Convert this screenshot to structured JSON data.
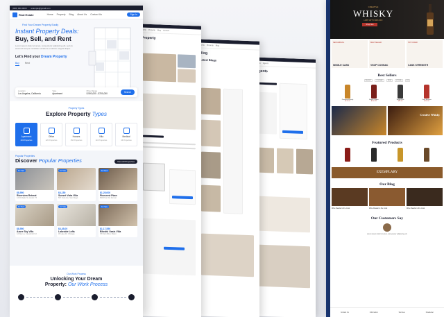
{
  "front": {
    "topbar": {
      "phone": "(000) 000-0000",
      "email": "example@gmail.com"
    },
    "logo": "Real Estate",
    "nav": [
      "Home",
      "Property",
      "Blog",
      "About Us",
      "Contact Us"
    ],
    "signin": "Sign In",
    "hero": {
      "eyebrow": "Find Your Dream Property Easily",
      "title1": "Instant Property Deals:",
      "title2": "Buy, Sell, and Rent",
      "desc": "Lorem ipsum dolor sit amet, consectetur adipiscing elit, sed do eiusmod tempor incididunt ut labore et dolore magna aliqua.",
      "find_prefix": "Let's Find your ",
      "find_highlight": "Dream Property",
      "tabs": [
        "Buy",
        "Rent"
      ],
      "search": {
        "location_label": "Location",
        "location_value": "Los Angeles, California",
        "type_label": "Type",
        "type_value": "Apartment",
        "price_label": "Price Range",
        "price_value": "$ 500,000 - $700,000",
        "button": "Search"
      }
    },
    "types": {
      "eyebrow": "Property Types",
      "title": "Explore Property",
      "title_em": "Types",
      "items": [
        {
          "name": "Apartment",
          "count": "234 Properties"
        },
        {
          "name": "Office",
          "count": "120 Properties"
        },
        {
          "name": "Houses",
          "count": "150 Properties"
        },
        {
          "name": "Villa",
          "count": "110 Properties"
        },
        {
          "name": "Medical",
          "count": "46 Properties"
        }
      ]
    },
    "popular": {
      "eyebrow": "Popular Properties",
      "title": "Discover",
      "title_em": "Popular Properties",
      "view_all": "View All Properties",
      "cards": [
        {
          "badge": "For Sale",
          "price": "$8,950",
          "name": "Riverview Retreat",
          "addr": "1234 Maple St, Austin TX"
        },
        {
          "badge": "For Sale",
          "price": "$4,150",
          "name": "Sunset Vista Villa",
          "addr": "567 Oak Ave, San Diego"
        },
        {
          "badge": "For Rent",
          "price": "$1,25,000",
          "name": "Pinecrest Place",
          "addr": "890 Pine Rd, Denver"
        },
        {
          "badge": "For Rent",
          "price": "$8,950",
          "name": "Azure Sky Villa",
          "addr": "12 Sky Ln, Cloudcroft NJ"
        },
        {
          "badge": "For Sale",
          "price": "$4,45,00",
          "name": "Lakeside Lofts",
          "addr": "45 Lake Dr, Chicago"
        },
        {
          "badge": "For Sale",
          "price": "$1,17,550",
          "name": "Blissful Oasis Villa",
          "addr": "78 Palm Blvd, Miami"
        }
      ]
    },
    "process": {
      "eyebrow": "Our Work Process",
      "title1": "Unlocking Your Dream",
      "title2": "Property:",
      "title_em": "Our Work Process"
    }
  },
  "pages": {
    "property_title": "Property",
    "blog_title": "Blog",
    "blogs_sub": "Latest Blogs",
    "agents_title": "Agents"
  },
  "whisky": {
    "top": "CREATIVE",
    "title": "WHISKY",
    "sub": "LIMIT UP TO 30% OFF",
    "button": "Shop Now",
    "cats": [
      {
        "tag": "NEW ARRIVAL",
        "label": "SINGLE CASK"
      },
      {
        "tag": "BEST SELLER",
        "label": "VSOP COGNAC"
      },
      {
        "tag": "HOT OFFER",
        "label": "CASK STRENGTH"
      }
    ],
    "best_sellers": "Best Sellers",
    "tabs": [
      "WHISKY",
      "COGNAC",
      "RUM",
      "VODKA",
      "GIN"
    ],
    "products": [
      {
        "name": "Premium Whisky",
        "price": "$120.00"
      },
      {
        "name": "Royal Cognac",
        "price": "$150.00"
      },
      {
        "name": "Single Malt",
        "price": "$95.00"
      },
      {
        "name": "Cask Reserve",
        "price": "$110.00"
      }
    ],
    "banner_label": "Creative Whisky",
    "featured": "Featured Products",
    "strip": "EXEMPLARY",
    "our_blog": "Our Blog",
    "blog_caps": [
      "Wine Reader is the most",
      "Wine Reader is the most",
      "Wine Reader is the most"
    ],
    "customers": "Our Customers Say",
    "quote": "Lorem ipsum dolor sit amet, consectetur adipiscing elit.",
    "footer": [
      "Contact Us",
      "Information",
      "Services",
      "Newsletter"
    ]
  }
}
